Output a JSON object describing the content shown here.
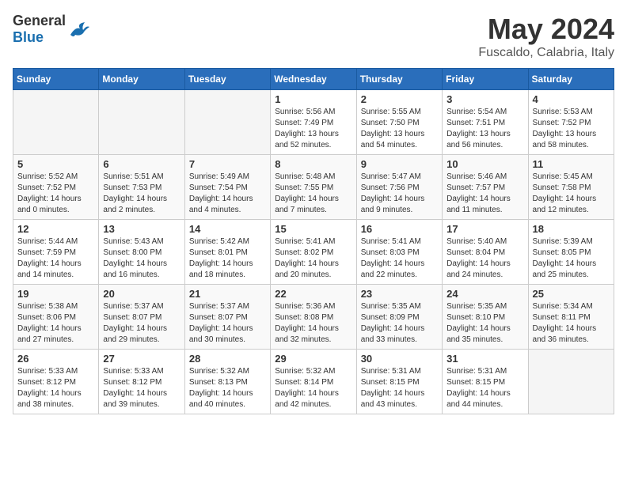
{
  "header": {
    "logo_general": "General",
    "logo_blue": "Blue",
    "month": "May 2024",
    "location": "Fuscaldo, Calabria, Italy"
  },
  "days_of_week": [
    "Sunday",
    "Monday",
    "Tuesday",
    "Wednesday",
    "Thursday",
    "Friday",
    "Saturday"
  ],
  "weeks": [
    [
      {
        "day": "",
        "empty": true
      },
      {
        "day": "",
        "empty": true
      },
      {
        "day": "",
        "empty": true
      },
      {
        "day": "1",
        "sunrise": "5:56 AM",
        "sunset": "7:49 PM",
        "daylight": "Daylight: 13 hours and 52 minutes."
      },
      {
        "day": "2",
        "sunrise": "5:55 AM",
        "sunset": "7:50 PM",
        "daylight": "Daylight: 13 hours and 54 minutes."
      },
      {
        "day": "3",
        "sunrise": "5:54 AM",
        "sunset": "7:51 PM",
        "daylight": "Daylight: 13 hours and 56 minutes."
      },
      {
        "day": "4",
        "sunrise": "5:53 AM",
        "sunset": "7:52 PM",
        "daylight": "Daylight: 13 hours and 58 minutes."
      }
    ],
    [
      {
        "day": "5",
        "sunrise": "5:52 AM",
        "sunset": "7:52 PM",
        "daylight": "Daylight: 14 hours and 0 minutes."
      },
      {
        "day": "6",
        "sunrise": "5:51 AM",
        "sunset": "7:53 PM",
        "daylight": "Daylight: 14 hours and 2 minutes."
      },
      {
        "day": "7",
        "sunrise": "5:49 AM",
        "sunset": "7:54 PM",
        "daylight": "Daylight: 14 hours and 4 minutes."
      },
      {
        "day": "8",
        "sunrise": "5:48 AM",
        "sunset": "7:55 PM",
        "daylight": "Daylight: 14 hours and 7 minutes."
      },
      {
        "day": "9",
        "sunrise": "5:47 AM",
        "sunset": "7:56 PM",
        "daylight": "Daylight: 14 hours and 9 minutes."
      },
      {
        "day": "10",
        "sunrise": "5:46 AM",
        "sunset": "7:57 PM",
        "daylight": "Daylight: 14 hours and 11 minutes."
      },
      {
        "day": "11",
        "sunrise": "5:45 AM",
        "sunset": "7:58 PM",
        "daylight": "Daylight: 14 hours and 12 minutes."
      }
    ],
    [
      {
        "day": "12",
        "sunrise": "5:44 AM",
        "sunset": "7:59 PM",
        "daylight": "Daylight: 14 hours and 14 minutes."
      },
      {
        "day": "13",
        "sunrise": "5:43 AM",
        "sunset": "8:00 PM",
        "daylight": "Daylight: 14 hours and 16 minutes."
      },
      {
        "day": "14",
        "sunrise": "5:42 AM",
        "sunset": "8:01 PM",
        "daylight": "Daylight: 14 hours and 18 minutes."
      },
      {
        "day": "15",
        "sunrise": "5:41 AM",
        "sunset": "8:02 PM",
        "daylight": "Daylight: 14 hours and 20 minutes."
      },
      {
        "day": "16",
        "sunrise": "5:41 AM",
        "sunset": "8:03 PM",
        "daylight": "Daylight: 14 hours and 22 minutes."
      },
      {
        "day": "17",
        "sunrise": "5:40 AM",
        "sunset": "8:04 PM",
        "daylight": "Daylight: 14 hours and 24 minutes."
      },
      {
        "day": "18",
        "sunrise": "5:39 AM",
        "sunset": "8:05 PM",
        "daylight": "Daylight: 14 hours and 25 minutes."
      }
    ],
    [
      {
        "day": "19",
        "sunrise": "5:38 AM",
        "sunset": "8:06 PM",
        "daylight": "Daylight: 14 hours and 27 minutes."
      },
      {
        "day": "20",
        "sunrise": "5:37 AM",
        "sunset": "8:07 PM",
        "daylight": "Daylight: 14 hours and 29 minutes."
      },
      {
        "day": "21",
        "sunrise": "5:37 AM",
        "sunset": "8:07 PM",
        "daylight": "Daylight: 14 hours and 30 minutes."
      },
      {
        "day": "22",
        "sunrise": "5:36 AM",
        "sunset": "8:08 PM",
        "daylight": "Daylight: 14 hours and 32 minutes."
      },
      {
        "day": "23",
        "sunrise": "5:35 AM",
        "sunset": "8:09 PM",
        "daylight": "Daylight: 14 hours and 33 minutes."
      },
      {
        "day": "24",
        "sunrise": "5:35 AM",
        "sunset": "8:10 PM",
        "daylight": "Daylight: 14 hours and 35 minutes."
      },
      {
        "day": "25",
        "sunrise": "5:34 AM",
        "sunset": "8:11 PM",
        "daylight": "Daylight: 14 hours and 36 minutes."
      }
    ],
    [
      {
        "day": "26",
        "sunrise": "5:33 AM",
        "sunset": "8:12 PM",
        "daylight": "Daylight: 14 hours and 38 minutes."
      },
      {
        "day": "27",
        "sunrise": "5:33 AM",
        "sunset": "8:12 PM",
        "daylight": "Daylight: 14 hours and 39 minutes."
      },
      {
        "day": "28",
        "sunrise": "5:32 AM",
        "sunset": "8:13 PM",
        "daylight": "Daylight: 14 hours and 40 minutes."
      },
      {
        "day": "29",
        "sunrise": "5:32 AM",
        "sunset": "8:14 PM",
        "daylight": "Daylight: 14 hours and 42 minutes."
      },
      {
        "day": "30",
        "sunrise": "5:31 AM",
        "sunset": "8:15 PM",
        "daylight": "Daylight: 14 hours and 43 minutes."
      },
      {
        "day": "31",
        "sunrise": "5:31 AM",
        "sunset": "8:15 PM",
        "daylight": "Daylight: 14 hours and 44 minutes."
      },
      {
        "day": "",
        "empty": true
      }
    ]
  ]
}
